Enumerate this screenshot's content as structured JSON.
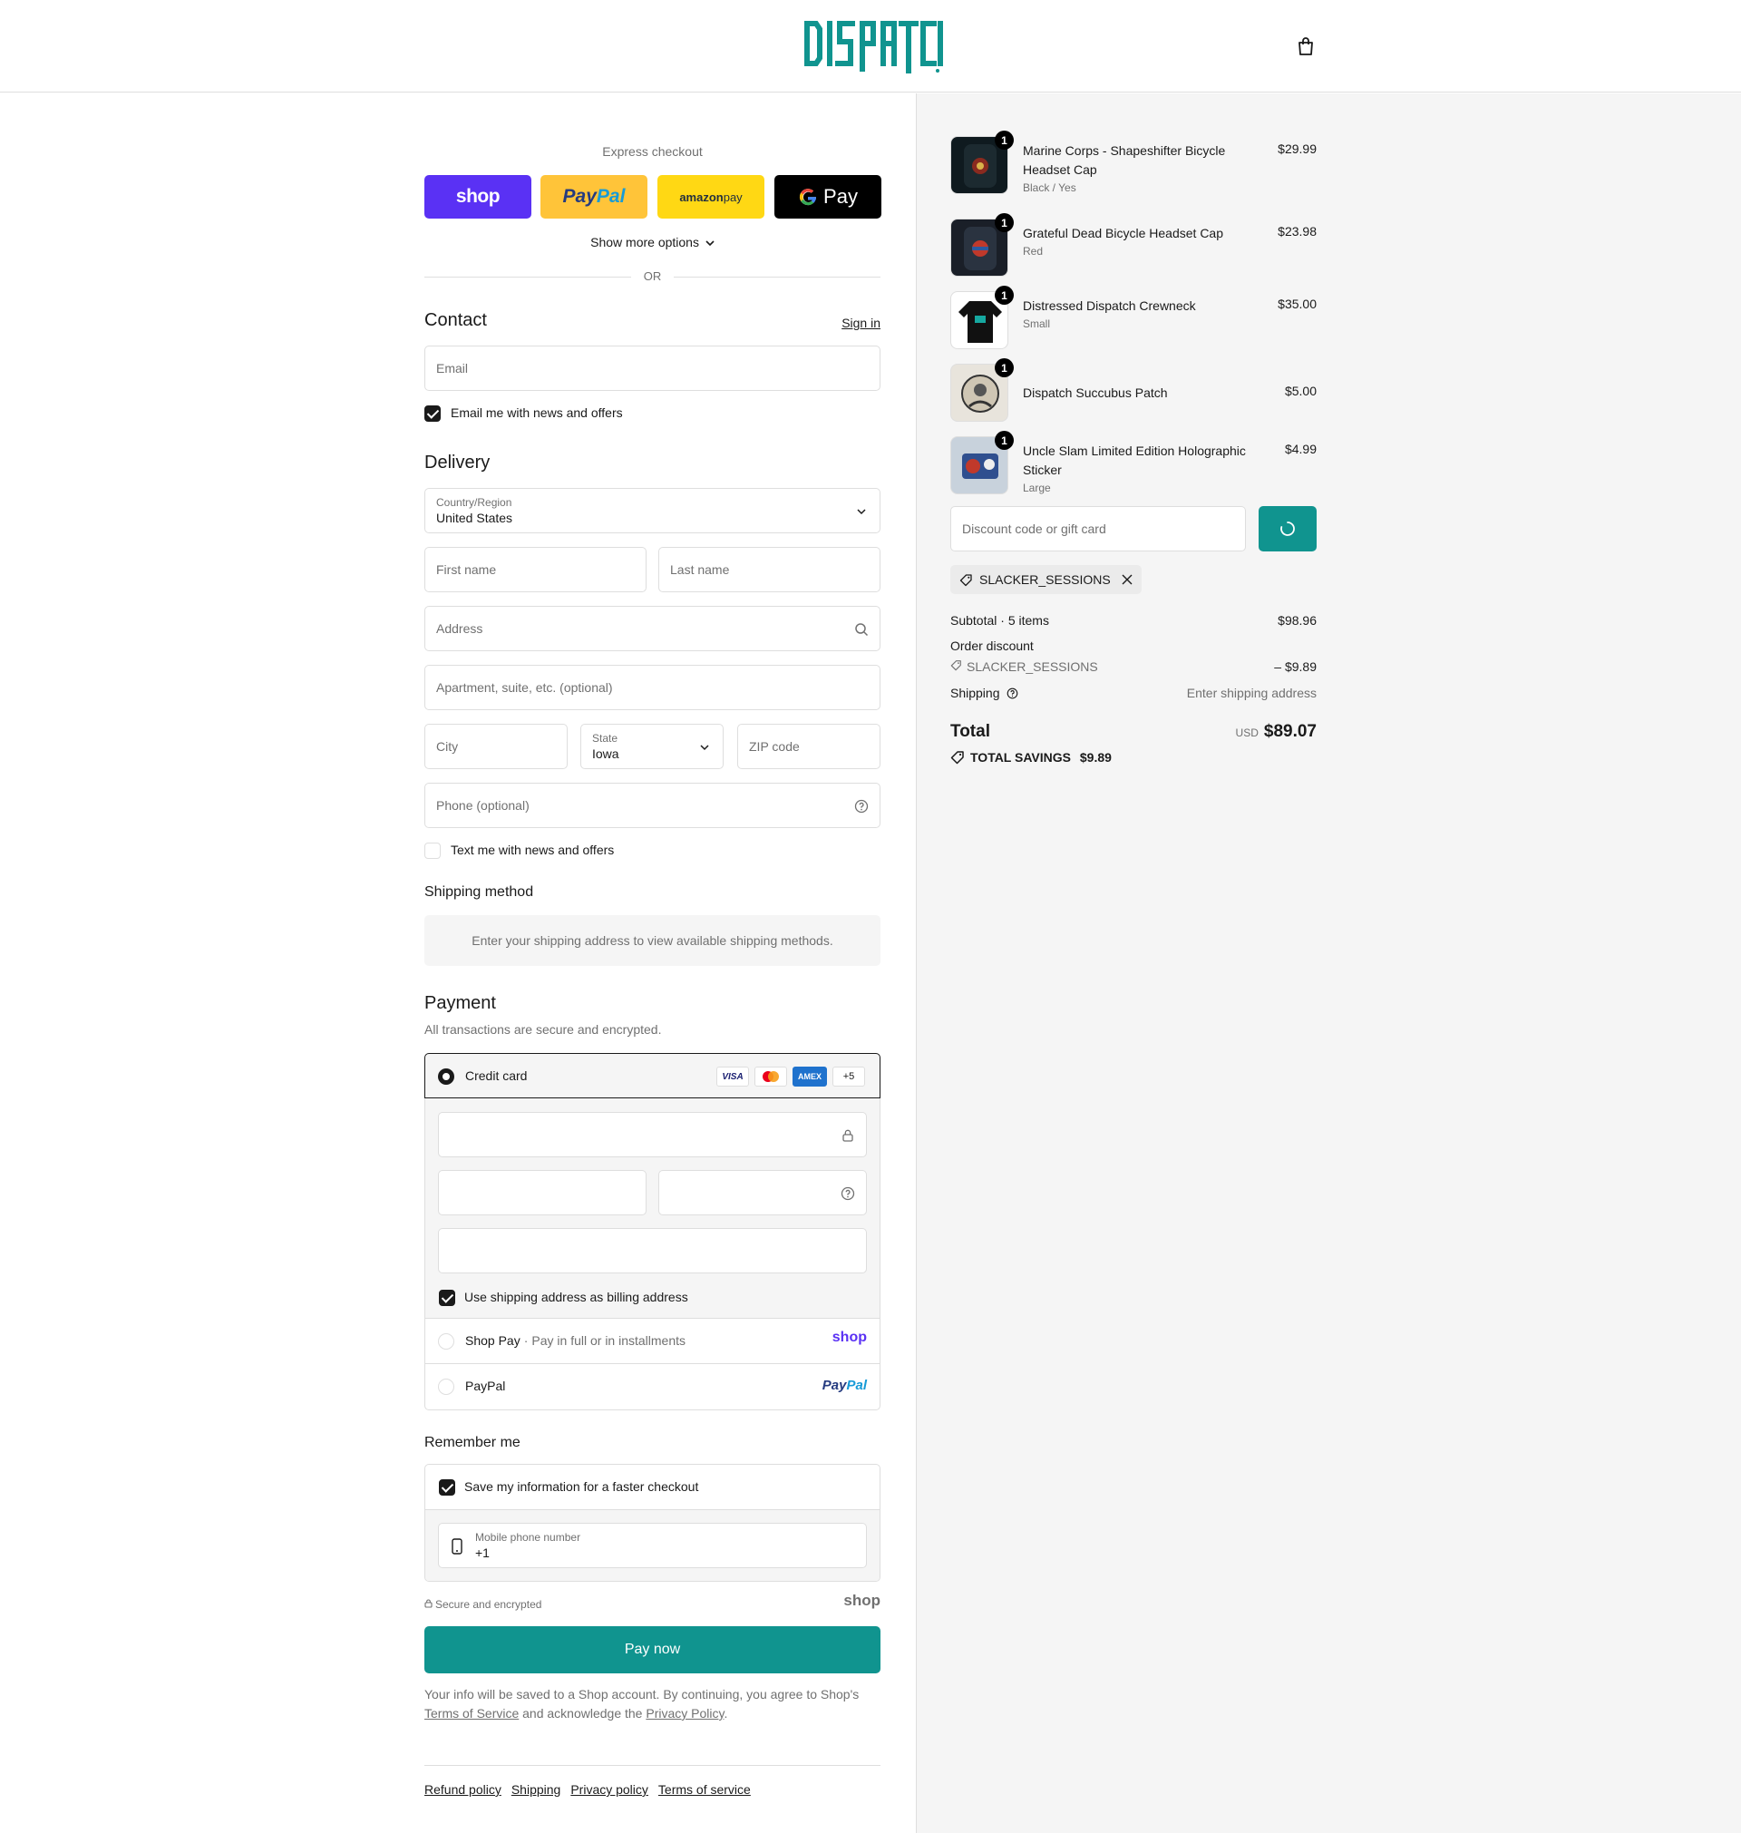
{
  "header": {
    "brand": "DISPATCH"
  },
  "express": {
    "title": "Express checkout",
    "shop_label": "shop",
    "paypal_a": "Pay",
    "paypal_b": "Pal",
    "amazon_a": "amazon",
    "amazon_b": " pay",
    "gpay_label": "Pay",
    "more_options": "Show more options",
    "or": "OR"
  },
  "contact": {
    "title": "Contact",
    "sign_in": "Sign in",
    "email_placeholder": "Email",
    "newsletter_label": "Email me with news and offers",
    "newsletter_checked": true
  },
  "delivery": {
    "title": "Delivery",
    "country_label": "Country/Region",
    "country_value": "United States",
    "first_name": "First name",
    "last_name": "Last name",
    "address": "Address",
    "apartment": "Apartment, suite, etc. (optional)",
    "city": "City",
    "state_label": "State",
    "state_value": "Iowa",
    "zip": "ZIP code",
    "phone": "Phone (optional)",
    "sms_label": "Text me with news and offers",
    "sms_checked": false
  },
  "shipping_method": {
    "title": "Shipping method",
    "info": "Enter your shipping address to view available shipping methods."
  },
  "payment": {
    "title": "Payment",
    "subtitle": "All transactions are secure and encrypted.",
    "credit_card_label": "Credit card",
    "brands": [
      "VISA",
      "AMEX",
      "+5"
    ],
    "billing_label": "Use shipping address as billing address",
    "billing_checked": true,
    "shop_pay_label": "Shop Pay",
    "shop_pay_sub": "Pay in full or in installments",
    "shop_pay_logo": "shop",
    "paypal_label": "PayPal",
    "paypal_logo_a": "Pay",
    "paypal_logo_b": "Pal"
  },
  "remember": {
    "title": "Remember me",
    "save_label": "Save my information for a faster checkout",
    "save_checked": true,
    "phone_label": "Mobile phone number",
    "phone_value": "+1"
  },
  "secure": {
    "label": "Secure and encrypted",
    "logo": "shop"
  },
  "pay_now": "Pay now",
  "legal": {
    "text1": "Your info will be saved to a Shop account. By continuing, you agree to Shop's",
    "tos": "Terms of Service",
    "text2": " and acknowledge the ",
    "privacy": "Privacy Policy",
    "text3": "."
  },
  "footer": [
    "Refund policy",
    "Shipping",
    "Privacy policy",
    "Terms of service"
  ],
  "cart": {
    "items": [
      {
        "qty": "1",
        "name": "Marine Corps - Shapeshifter Bicycle Headset Cap",
        "variant": "Black / Yes",
        "price": "$29.99"
      },
      {
        "qty": "1",
        "name": "Grateful Dead Bicycle Headset Cap",
        "variant": "Red",
        "price": "$23.98"
      },
      {
        "qty": "1",
        "name": "Distressed Dispatch Crewneck",
        "variant": "Small",
        "price": "$35.00"
      },
      {
        "qty": "1",
        "name": "Dispatch Succubus Patch",
        "variant": "",
        "price": "$5.00"
      },
      {
        "qty": "1",
        "name": "Uncle Slam Limited Edition Holographic Sticker",
        "variant": "Large",
        "price": "$4.99"
      }
    ],
    "discount_placeholder": "Discount code or gift card",
    "applied_code": "SLACKER_SESSIONS",
    "subtotal_label": "Subtotal · 5 items",
    "subtotal_value": "$98.96",
    "order_discount_label": "Order discount",
    "discount_code": "SLACKER_SESSIONS",
    "discount_value": "– $9.89",
    "shipping_label": "Shipping",
    "shipping_value": "Enter shipping address",
    "total_label": "Total",
    "currency": "USD",
    "total_value": "$89.07",
    "savings_label": "TOTAL SAVINGS",
    "savings_value": "$9.89"
  },
  "colors": {
    "accent": "#10948f",
    "shop": "#5a31f4",
    "paypal": "#ffc439",
    "amazon": "#ffd814"
  }
}
